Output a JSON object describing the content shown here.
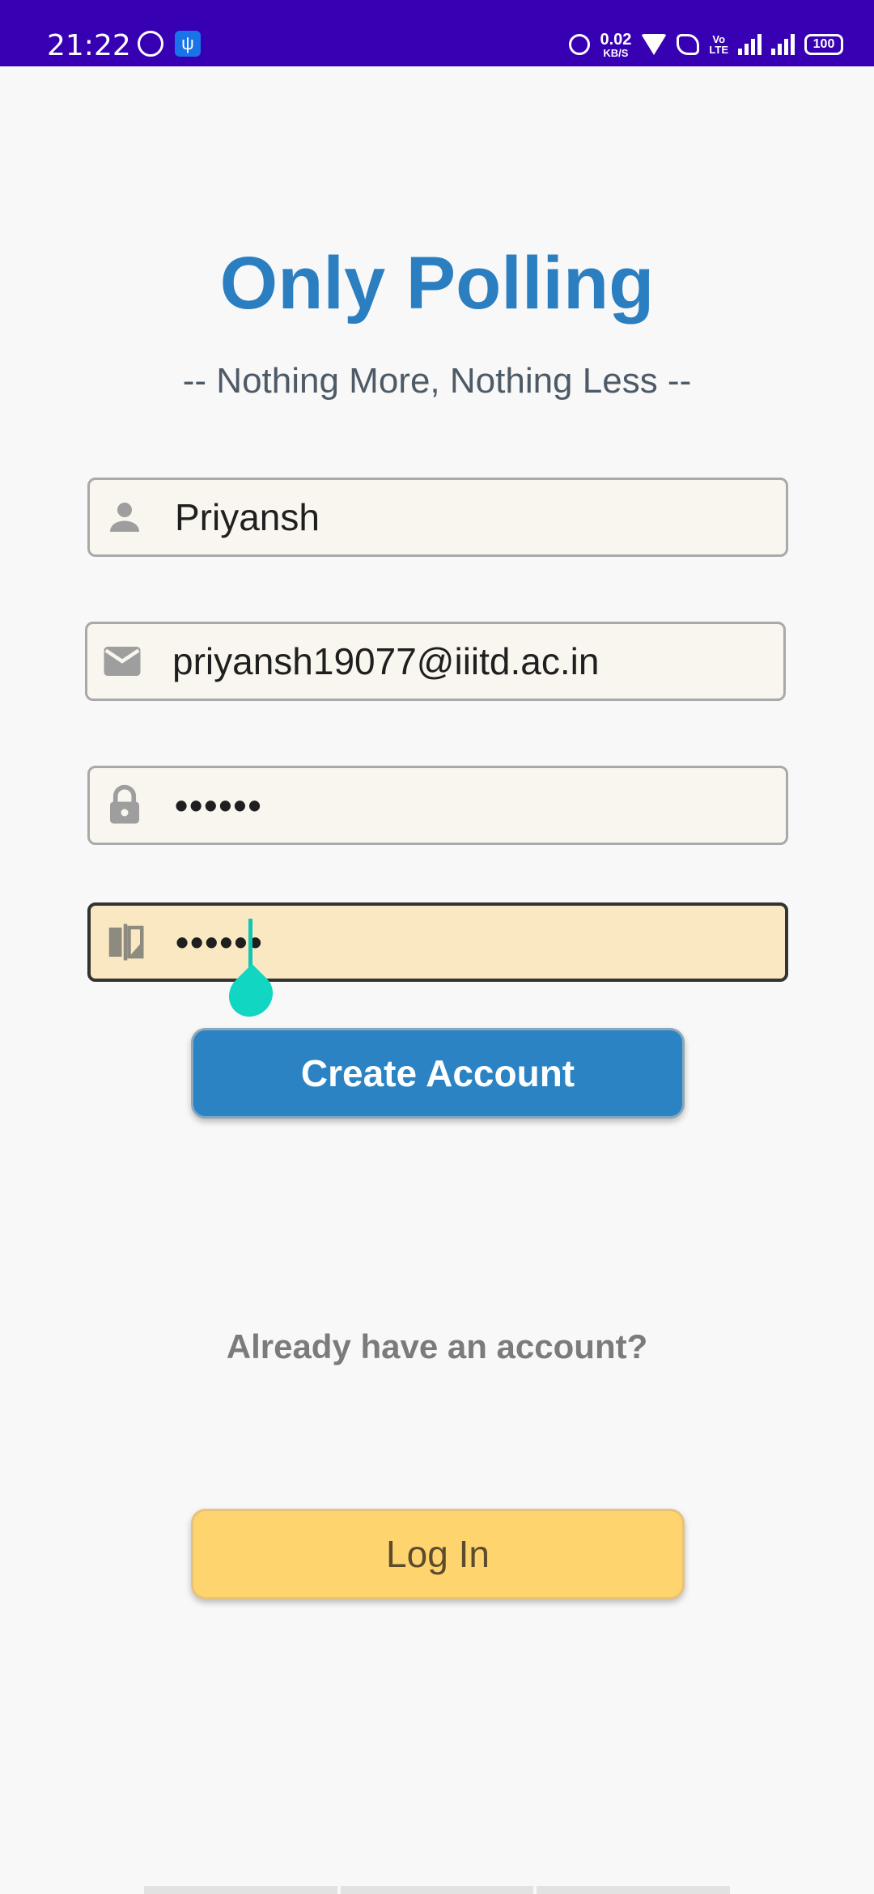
{
  "status_bar": {
    "time": "21:22",
    "net_speed_value": "0.02",
    "net_speed_unit": "KB/S",
    "volte_top": "Vo",
    "volte_bottom": "LTE",
    "battery": "100",
    "icons": [
      "whatsapp-icon",
      "usb-icon",
      "alarm-icon",
      "wifi-icon",
      "wifi-call-icon",
      "volte-icon",
      "signal-icon",
      "signal-icon",
      "battery-icon"
    ],
    "bar_color": "#3700b3"
  },
  "app": {
    "title": "Only Polling",
    "tagline": "--  Nothing More, Nothing Less  --",
    "accent_color": "#2b7fc0"
  },
  "form": {
    "name_value": "Priyansh",
    "name_icon": "person-icon",
    "email_value": "priyansh19077@iiitd.ac.in",
    "email_icon": "mail-icon",
    "password_value": "••••••",
    "password_icon": "lock-icon",
    "confirm_password_value": "••••••",
    "confirm_password_icon": "compare-icon"
  },
  "actions": {
    "create_account_label": "Create Account",
    "already_have_account": "Already have an account?",
    "login_label": "Log In",
    "create_color": "#2b83c3",
    "login_color": "#fed46f"
  }
}
